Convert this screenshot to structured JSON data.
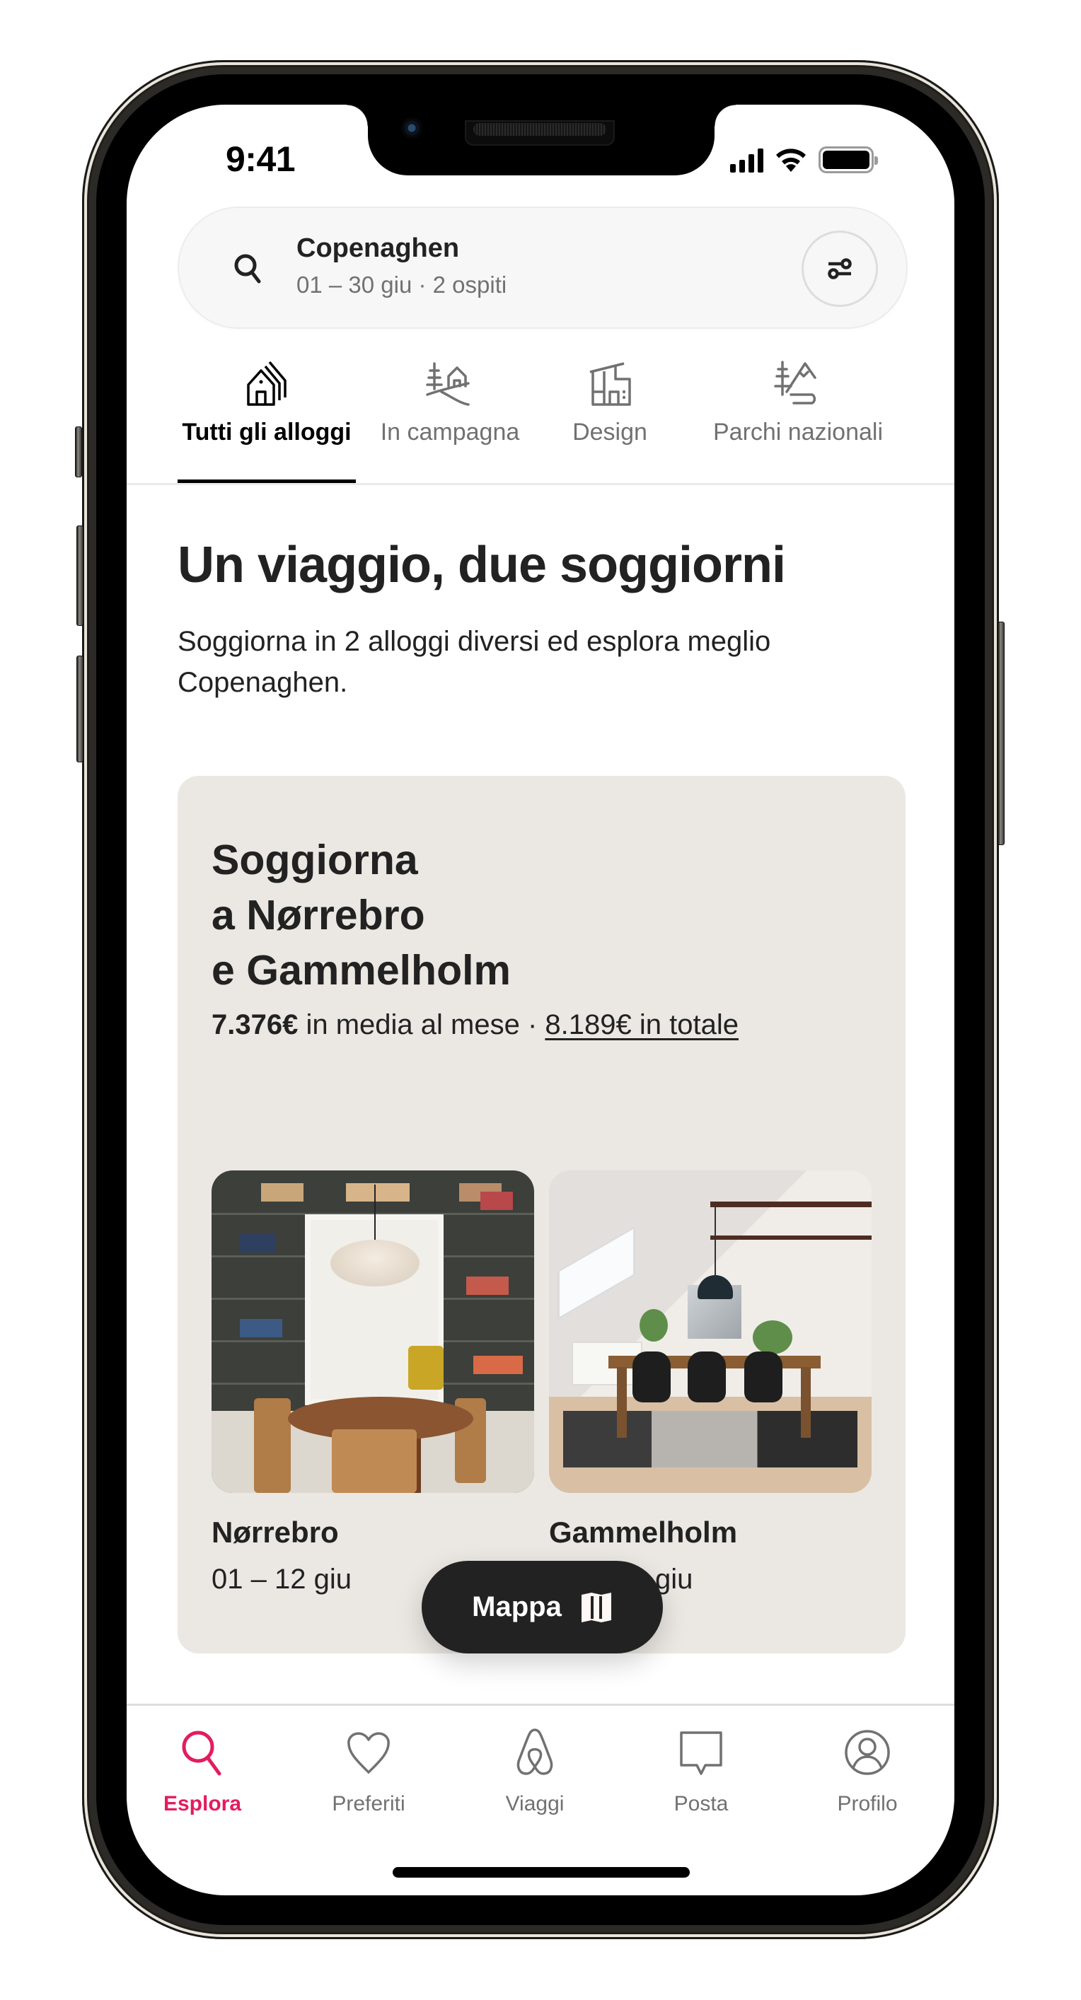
{
  "status_bar": {
    "time": "9:41"
  },
  "search": {
    "title": "Copenaghen",
    "subtitle": "01 – 30 giu · 2 ospiti",
    "filter_icon": "sliders-icon"
  },
  "categories": {
    "active_index": 0,
    "items": [
      {
        "label": "Tutti gli alloggi",
        "icon": "houses-icon"
      },
      {
        "label": "In campagna",
        "icon": "countryside-icon"
      },
      {
        "label": "Design",
        "icon": "modern-house-icon"
      },
      {
        "label": "Parchi nazionali",
        "icon": "national-park-icon"
      }
    ]
  },
  "headline": {
    "title": "Un viaggio, due soggiorni",
    "description": "Soggiorna in 2 alloggi diversi ed esplora meglio Copenaghen."
  },
  "trip_card": {
    "title_lines": [
      "Soggiorna",
      "a Nørrebro",
      "e Gammelholm"
    ],
    "price_monthly": "7.376€",
    "price_monthly_suffix": "in media al mese ·",
    "price_total": "8.189€ in totale",
    "stays": [
      {
        "name": "Nørrebro",
        "dates": "01 – 12 giu"
      },
      {
        "name": "Gammelholm",
        "dates": "giu"
      }
    ]
  },
  "map_button": {
    "label": "Mappa",
    "icon": "map-icon"
  },
  "bottom_nav": {
    "active_index": 0,
    "accent_color": "#E31C5F",
    "items": [
      {
        "label": "Esplora",
        "icon": "search-icon"
      },
      {
        "label": "Preferiti",
        "icon": "heart-icon"
      },
      {
        "label": "Viaggi",
        "icon": "airbnb-logo-icon"
      },
      {
        "label": "Posta",
        "icon": "message-icon"
      },
      {
        "label": "Profilo",
        "icon": "profile-icon"
      }
    ]
  }
}
